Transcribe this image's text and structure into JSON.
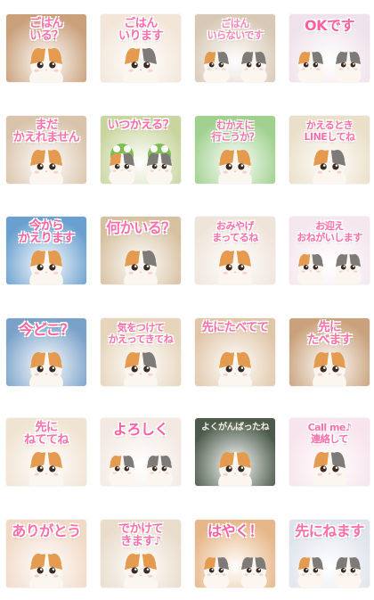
{
  "stickers": [
    {
      "id": "gohan-iru",
      "text": "ごはん\nいる？",
      "color": "#ff6fa8",
      "bg": "#c9a07a",
      "cat": "calico"
    },
    {
      "id": "gohan-irimasu",
      "text": "ごはん\nいります",
      "color": "#ff6fa8",
      "bg": "#f3e6d8",
      "cat": "white"
    },
    {
      "id": "gohan-iranai",
      "text": "ごはん\nいらないです",
      "color": "#ff86b4",
      "bg": "#d8c9b6",
      "cat": "two"
    },
    {
      "id": "ok",
      "text": "OKです",
      "color": "#ff5fa0",
      "bg": "#efe2ea",
      "cat": "two"
    },
    {
      "id": "mada-kaeremasen",
      "text": "まだ\nかえれません",
      "color": "#ff6fa8",
      "bg": "#d9c3aa",
      "cat": "calico"
    },
    {
      "id": "itsu-kaeru",
      "text": "いつかえる？",
      "color": "#ff6fa8",
      "bg": "#c8d59f",
      "cat": "frog"
    },
    {
      "id": "mukae-ni",
      "text": "むかえに\n行こうか？",
      "color": "#ff6fa8",
      "bg": "#9fd08e",
      "cat": "calico"
    },
    {
      "id": "kaeru-toki-line",
      "text": "かえるとき\nLINEしてね",
      "color": "#ff6fa8",
      "bg": "#eadfc8",
      "cat": "white"
    },
    {
      "id": "ima-kara-kaerimasu",
      "text": "今から\nかえります",
      "color": "#ff5fa0",
      "bg": "#6aa0cf",
      "cat": "calico"
    },
    {
      "id": "nani-ka-iru",
      "text": "何かいる？",
      "color": "#ff6fa8",
      "bg": "#d6c0a0",
      "cat": "white"
    },
    {
      "id": "omiyage",
      "text": "おみやげ\nまってるね",
      "color": "#ff6fa8",
      "bg": "#efe4da",
      "cat": "calico"
    },
    {
      "id": "omukae-onegai",
      "text": "お迎え\nおねがいします",
      "color": "#ff6fa8",
      "bg": "#f4e7ee",
      "cat": "two"
    },
    {
      "id": "ima-doko",
      "text": "今どこ？",
      "color": "#ff5fa0",
      "bg": "#7aa2c9",
      "cat": "calico"
    },
    {
      "id": "ki-wo-tsukete",
      "text": "気をつけて\nかえってきてね",
      "color": "#ff6fa8",
      "bg": "#e6d4bb",
      "cat": "white"
    },
    {
      "id": "saki-ni-tabete-te",
      "text": "先にたべてて",
      "color": "#ff6fa8",
      "bg": "#e0c6a8",
      "cat": "calico"
    },
    {
      "id": "saki-ni-tabemasu",
      "text": "先に\nたべます",
      "color": "#ff6fa8",
      "bg": "#c9a27c",
      "cat": "calico"
    },
    {
      "id": "saki-ni-nete-te",
      "text": "先に\nねててね",
      "color": "#ff6fa8",
      "bg": "#f1e3d2",
      "cat": "calico"
    },
    {
      "id": "yoroshiku",
      "text": "よろしく",
      "color": "#ff5fa0",
      "bg": "#f3e9e2",
      "cat": "two"
    },
    {
      "id": "yoku-ganbatta",
      "text": "よくがんばったね",
      "color": "#f3efe2",
      "bg": "#4b5a4a",
      "cat": "calico"
    },
    {
      "id": "renraku-shite",
      "text": "Call me♪\n連絡して",
      "color": "#ff6fa8",
      "bg": "#f7e4ec",
      "cat": "white"
    },
    {
      "id": "arigatou",
      "text": "ありがとう",
      "color": "#ff6fa8",
      "bg": "#f1d9c6",
      "cat": "calico"
    },
    {
      "id": "itte-kimasu",
      "text": "でかけて\nきます♪",
      "color": "#ff6fa8",
      "bg": "#e9dccb",
      "cat": "calico"
    },
    {
      "id": "hayaku",
      "text": "はやく！",
      "color": "#ff5fa0",
      "bg": "#e7b789",
      "cat": "two"
    },
    {
      "id": "saki-ni-nemasu",
      "text": "先にねます",
      "color": "#ff6fa8",
      "bg": "#dfe4ec",
      "cat": "two"
    }
  ]
}
